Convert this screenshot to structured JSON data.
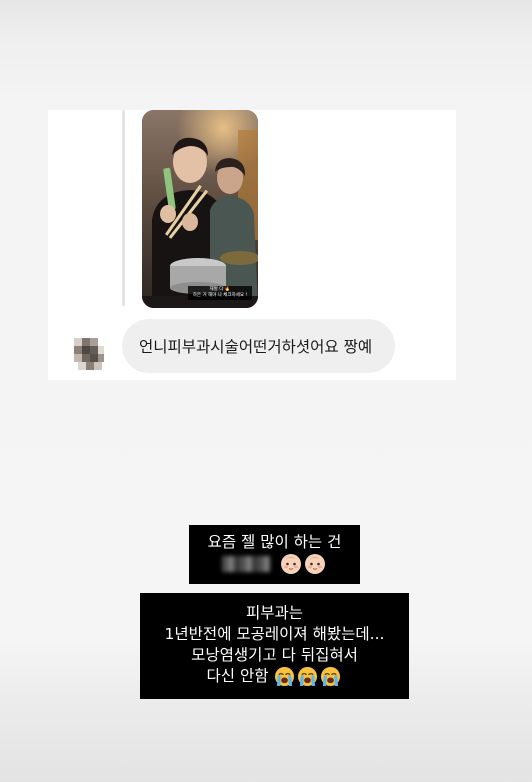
{
  "dm": {
    "story_caption_line1": "재벌 다 🔥",
    "story_caption_line2": "하은 거 해야 나 체크하세요 !",
    "message_text": "언니피부과시술어떤거하셧어요 짱예"
  },
  "story_text": {
    "box1_line1": "요즘 젤 많이 하는 건",
    "box2_line1": "피부과는",
    "box2_line2": "1년반전에 모공레이져 해봤는데...",
    "box2_line3": "모낭염생기고 다 뒤집혀서",
    "box2_line4": "다신 안함"
  },
  "icons": {
    "baby_face": "baby-face-icon",
    "crying_face": "loudly-crying-face-icon",
    "avatar": "blurred-avatar"
  },
  "colors": {
    "bubble_bg": "#efefef",
    "text_box_bg": "#000000",
    "text_box_fg": "#ffffff"
  }
}
